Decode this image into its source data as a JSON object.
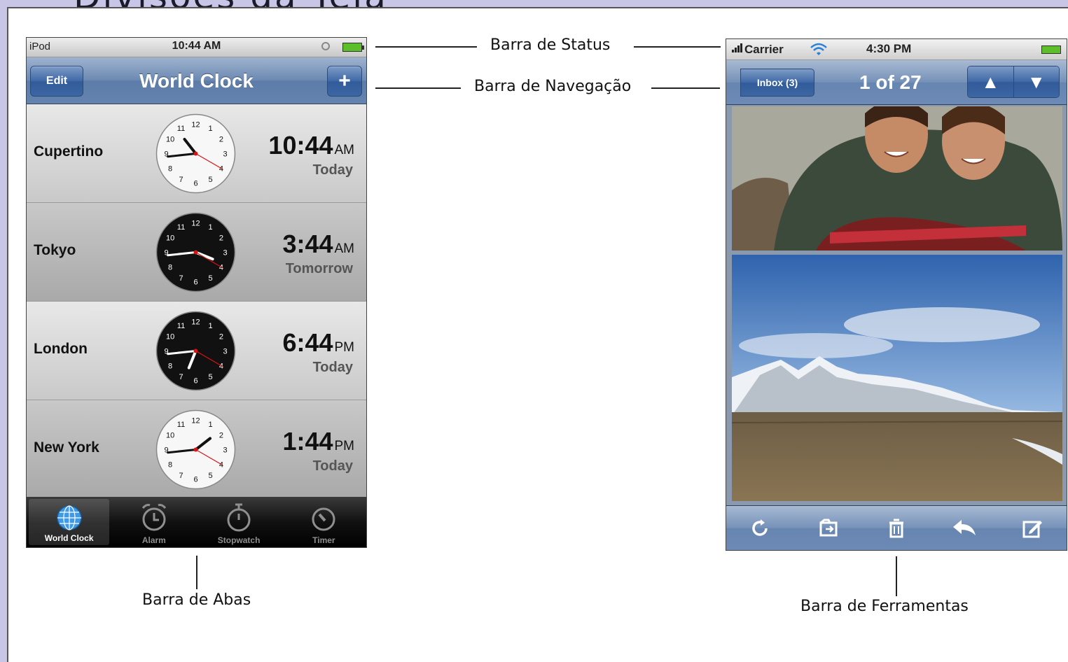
{
  "page": {
    "title": "Divisões da Tela"
  },
  "annotations": {
    "status_bar": "Barra de Status",
    "nav_bar": "Barra de Navegação",
    "tab_bar": "Barra de Abas",
    "toolbar": "Barra de Ferramentas"
  },
  "left_phone": {
    "status": {
      "carrier": "iPod",
      "time": "10:44 AM"
    },
    "nav": {
      "edit_label": "Edit",
      "title": "World Clock",
      "add_label": "+"
    },
    "rows": [
      {
        "city": "Cupertino",
        "time": "10:44",
        "ampm": "AM",
        "day": "Today",
        "clock_face": "light"
      },
      {
        "city": "Tokyo",
        "time": "3:44",
        "ampm": "AM",
        "day": "Tomorrow",
        "clock_face": "dark"
      },
      {
        "city": "London",
        "time": "6:44",
        "ampm": "PM",
        "day": "Today",
        "clock_face": "dark"
      },
      {
        "city": "New York",
        "time": "1:44",
        "ampm": "PM",
        "day": "Today",
        "clock_face": "light"
      }
    ],
    "tabs": [
      {
        "label": "World Clock",
        "icon": "globe-icon",
        "active": true
      },
      {
        "label": "Alarm",
        "icon": "alarm-icon",
        "active": false
      },
      {
        "label": "Stopwatch",
        "icon": "stopwatch-icon",
        "active": false
      },
      {
        "label": "Timer",
        "icon": "timer-icon",
        "active": false
      }
    ]
  },
  "right_phone": {
    "status": {
      "carrier": "Carrier",
      "time": "4:30 PM"
    },
    "nav": {
      "back_label": "Inbox (3)",
      "title": "1 of 27",
      "up_label": "▲",
      "down_label": "▼"
    },
    "toolbar": [
      {
        "icon": "refresh-icon"
      },
      {
        "icon": "move-to-folder-icon"
      },
      {
        "icon": "trash-icon"
      },
      {
        "icon": "reply-icon"
      },
      {
        "icon": "compose-icon"
      }
    ],
    "photos": [
      {
        "icon": "photo-two-women-icon"
      },
      {
        "icon": "photo-mountain-landscape-icon"
      }
    ]
  },
  "colors": {
    "frame_background": "#c9c5e6",
    "nav_blue": "#6c89b2",
    "battery_green": "#5cbf2a"
  }
}
